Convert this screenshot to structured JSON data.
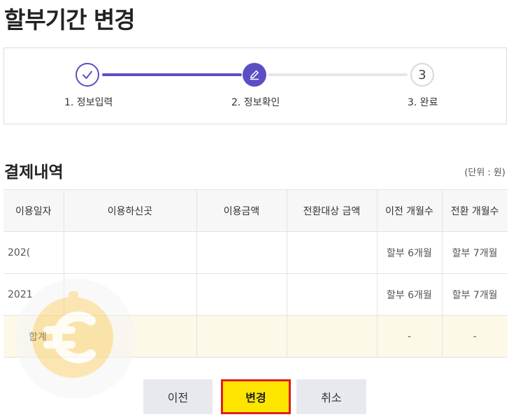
{
  "page": {
    "title": "할부기간 변경"
  },
  "stepper": {
    "steps": [
      {
        "label": "1. 정보입력",
        "state": "done",
        "icon": "check-icon"
      },
      {
        "label": "2. 정보확인",
        "state": "current",
        "icon": "pencil-icon"
      },
      {
        "label": "3. 완료",
        "state": "pending",
        "number": "3"
      }
    ],
    "accent_color": "#5b4ec4"
  },
  "section": {
    "title": "결제내역",
    "unit_note": "(단위 : 원)"
  },
  "table": {
    "headers": [
      "이용일자",
      "이용하신곳",
      "이용금액",
      "전환대상 금액",
      "이전 개월수",
      "전환 개월수"
    ],
    "rows": [
      {
        "date": "202(",
        "place": "",
        "amount": "",
        "target": "",
        "prev": "할부 6개월",
        "next": "할부 7개월"
      },
      {
        "date": "2021",
        "place": "",
        "amount": "",
        "target": "",
        "prev": "할부 6개월",
        "next": "할부 7개월"
      }
    ],
    "total": {
      "label": "합계",
      "prev": "-",
      "next": "-"
    }
  },
  "buttons": {
    "prev": "이전",
    "change": "변경",
    "cancel": "취소"
  },
  "colors": {
    "highlight": "#fee500",
    "highlight_border": "#e11d1d",
    "total_row_bg": "#fdf9e8"
  }
}
